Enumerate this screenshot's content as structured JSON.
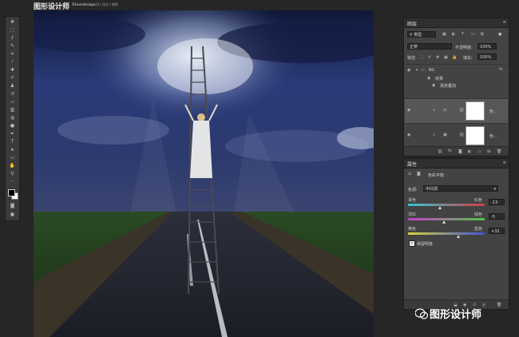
{
  "header": {
    "brand": "图形设计师",
    "brand_en": "Illustdesign",
    "sub": "UI | 设计 | 视觉"
  },
  "tools": [
    "move-tool",
    "marquee-tool",
    "lasso-tool",
    "quick-select-tool",
    "crop-tool",
    "eyedropper-tool",
    "healing-tool",
    "brush-tool",
    "stamp-tool",
    "history-brush-tool",
    "eraser-tool",
    "gradient-tool",
    "blur-tool",
    "dodge-tool",
    "pen-tool",
    "type-tool",
    "path-select-tool",
    "shape-tool",
    "hand-tool",
    "zoom-tool",
    "more-tools"
  ],
  "layers_panel": {
    "title": "图层",
    "filter_label": "类型",
    "blend_mode": "正常",
    "opacity_label": "不透明度:",
    "opacity_value": "100%",
    "lock_label": "锁定:",
    "fill_label": "填充:",
    "fill_value": "100%",
    "group_name": "BG",
    "effects_label": "效果",
    "effect_name": "渐变叠加",
    "layer1_name": "色...",
    "layer2_name": "色..."
  },
  "properties_panel": {
    "title": "属性",
    "adjustment_name": "色彩平衡",
    "tone_label": "色调:",
    "tone_value": "中间调",
    "slider1_left": "青色",
    "slider1_right": "红色",
    "slider1_value": "-13",
    "slider1_position": 0.42,
    "slider2_left": "洋红",
    "slider2_right": "绿色",
    "slider2_value": "-5",
    "slider2_position": 0.47,
    "slider3_left": "黄色",
    "slider3_right": "蓝色",
    "slider3_value": "+32",
    "slider3_position": 0.66,
    "preserve_label": "保留明度"
  },
  "watermark": "图形设计师"
}
